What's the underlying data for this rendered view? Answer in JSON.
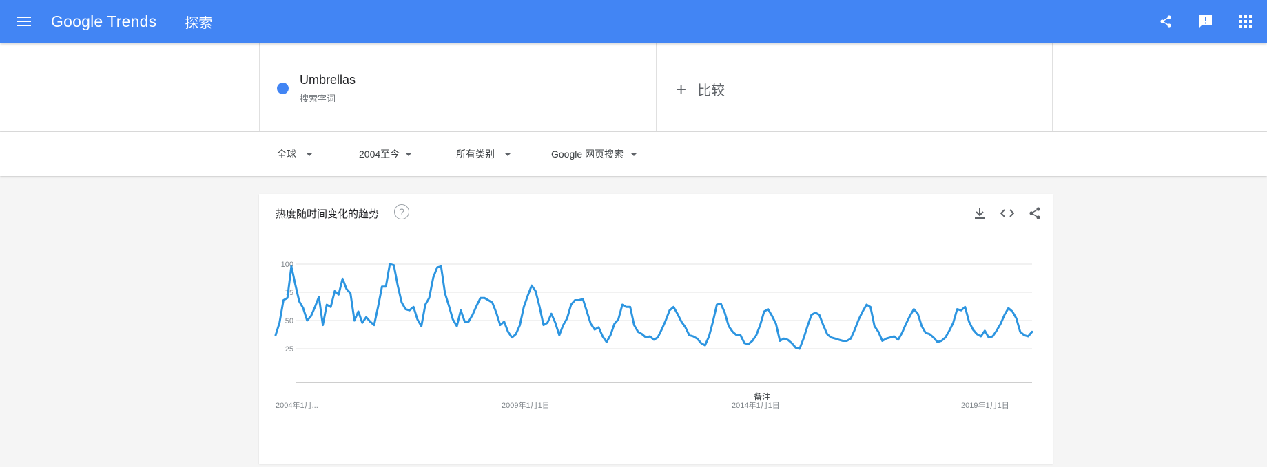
{
  "header": {
    "logo_google": "Google",
    "logo_trends": "Trends",
    "section": "探索",
    "icons": [
      "menu-icon",
      "share-icon",
      "feedback-icon",
      "apps-icon"
    ]
  },
  "terms": {
    "term1": {
      "name": "Umbrellas",
      "type": "搜索字词",
      "color": "#4285f4"
    },
    "compare_label": "比较",
    "compare_icon": "plus-icon"
  },
  "filters": {
    "region": "全球",
    "time": "2004至今",
    "category": "所有类别",
    "search_type": "Google 网页搜索"
  },
  "card": {
    "title": "热度随时间变化的趋势",
    "help": "?",
    "actions": [
      "download-icon",
      "embed-icon",
      "share-icon"
    ]
  },
  "colors": {
    "header": "#4285f4",
    "series": "#2d95e0"
  },
  "chart_data": {
    "type": "line",
    "ylim": [
      0,
      100
    ],
    "y_ticks": [
      "25",
      "50",
      "75",
      "100"
    ],
    "x_ticks": [
      "2004年1月...",
      "2009年1月1日",
      "2014年1月1日",
      "2019年1月1日"
    ],
    "annotation": "备注",
    "series": [
      {
        "values": [
          37,
          48,
          68,
          70,
          98,
          82,
          67,
          61,
          50,
          54,
          62,
          71,
          46,
          64,
          62,
          76,
          73,
          87,
          78,
          74,
          50,
          58,
          48,
          53,
          49,
          46,
          62,
          80,
          80,
          100,
          99,
          81,
          66,
          60,
          59,
          62,
          51,
          45,
          64,
          70,
          88,
          97,
          98,
          74,
          63,
          51,
          45,
          59,
          49,
          49,
          55,
          63,
          70,
          70,
          68,
          66,
          57,
          46,
          49,
          40,
          35,
          38,
          46,
          62,
          72,
          81,
          76,
          62,
          46,
          48,
          56,
          48,
          37,
          46,
          52,
          64,
          68,
          68,
          69,
          58,
          47,
          42,
          44,
          36,
          31,
          37,
          47,
          51,
          64,
          62,
          62,
          46,
          40,
          38,
          35,
          36,
          33,
          35,
          42,
          50,
          59,
          62,
          56,
          49,
          44,
          37,
          36,
          34,
          30,
          28,
          36,
          49,
          64,
          65,
          57,
          45,
          40,
          37,
          37,
          30,
          29,
          32,
          37,
          46,
          58,
          60,
          54,
          47,
          32,
          34,
          33,
          30,
          26,
          25,
          34,
          45,
          55,
          57,
          55,
          46,
          38,
          35,
          34,
          33,
          32,
          32,
          34,
          42,
          51,
          58,
          64,
          62,
          45,
          40,
          32,
          34,
          35,
          36,
          33,
          39,
          47,
          54,
          60,
          56,
          45,
          39,
          38,
          35,
          31,
          32,
          35,
          41,
          48,
          60,
          59,
          62,
          49,
          42,
          38,
          36,
          41,
          35,
          36,
          41,
          47,
          55,
          61,
          58,
          52,
          40,
          37,
          36,
          40
        ]
      }
    ]
  }
}
